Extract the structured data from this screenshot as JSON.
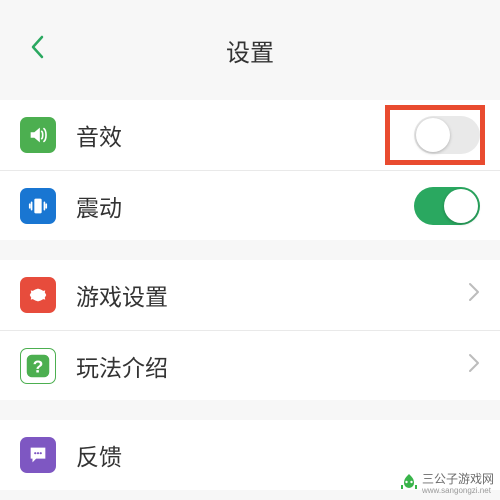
{
  "header": {
    "title": "设置"
  },
  "rows": {
    "sound": {
      "label": "音效",
      "icon_color": "#4caf50",
      "toggle_on": false
    },
    "vibrate": {
      "label": "震动",
      "icon_color": "#1976d2",
      "toggle_on": true
    },
    "game": {
      "label": "游戏设置",
      "icon_color": "#e74c3c"
    },
    "howto": {
      "label": "玩法介绍",
      "icon_color": "#4caf50"
    },
    "feedback": {
      "label": "反馈",
      "icon_color": "#7e57c2"
    }
  },
  "watermark": {
    "text": "三公子游戏网",
    "url": "www.sangongzi.net"
  }
}
